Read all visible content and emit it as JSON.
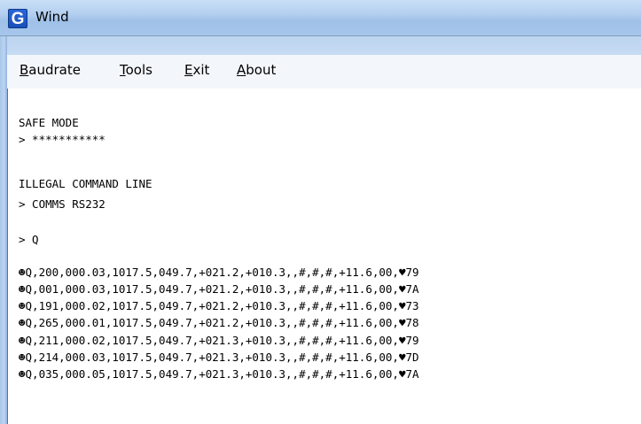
{
  "window": {
    "title": "Wind",
    "icon_letter": "G"
  },
  "menu": {
    "items": [
      {
        "prefix": "",
        "accel": "B",
        "rest": "audrate"
      },
      {
        "prefix": "",
        "accel": "T",
        "rest": "ools"
      },
      {
        "prefix": "",
        "accel": "E",
        "rest": "xit"
      },
      {
        "prefix": "",
        "accel": "A",
        "rest": "bout"
      }
    ]
  },
  "console": {
    "lines": [
      "SAFE MODE",
      "> ***********",
      "ILLEGAL COMMAND LINE",
      "> COMMS RS232",
      "> Q",
      "☻Q,200,000.03,1017.5,049.7,+021.2,+010.3,,#,#,#,+11.6,00,♥79",
      "☻Q,001,000.03,1017.5,049.7,+021.2,+010.3,,#,#,#,+11.6,00,♥7A",
      "☻Q,191,000.02,1017.5,049.7,+021.2,+010.3,,#,#,#,+11.6,00,♥73",
      "☻Q,265,000.01,1017.5,049.7,+021.2,+010.3,,#,#,#,+11.6,00,♥78",
      "☻Q,211,000.02,1017.5,049.7,+021.3,+010.3,,#,#,#,+11.6,00,♥79",
      "☻Q,214,000.03,1017.5,049.7,+021.3,+010.3,,#,#,#,+11.6,00,♥7D",
      "☻Q,035,000.05,1017.5,049.7,+021.3,+010.3,,#,#,#,+11.6,00,♥7A"
    ]
  },
  "colors": {
    "titlebar": "#b3cfef",
    "icon_blue": "#1a4fb8",
    "console_bg": "#ffffff"
  }
}
